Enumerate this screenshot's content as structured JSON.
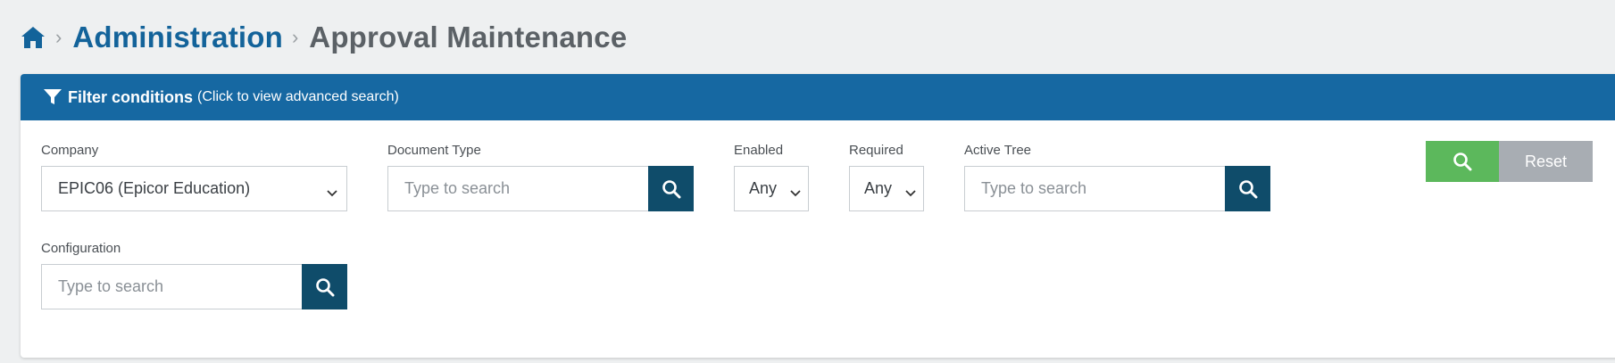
{
  "breadcrumb": {
    "home_icon": "home-icon",
    "separator": "›",
    "parent": "Administration",
    "current": "Approval Maintenance"
  },
  "filter_panel": {
    "title": "Filter conditions",
    "hint": "(Click to view advanced search)",
    "icon": "filter-icon",
    "header_color": "#1668a2",
    "fields": {
      "company": {
        "label": "Company",
        "value": "EPIC06 (Epicor Education)"
      },
      "document_type": {
        "label": "Document Type",
        "placeholder": "Type to search"
      },
      "enabled": {
        "label": "Enabled",
        "value": "Any"
      },
      "required": {
        "label": "Required",
        "value": "Any"
      },
      "active_tree": {
        "label": "Active Tree",
        "placeholder": "Type to search"
      },
      "configuration": {
        "label": "Configuration",
        "placeholder": "Type to search"
      }
    },
    "actions": {
      "search_icon": "search-icon",
      "search_color": "#5cb85c",
      "reset_label": "Reset",
      "reset_color": "#a8adb3"
    }
  },
  "colors": {
    "lookup_button": "#0f4c6a",
    "link": "#13639a",
    "background": "#eef0f1"
  }
}
